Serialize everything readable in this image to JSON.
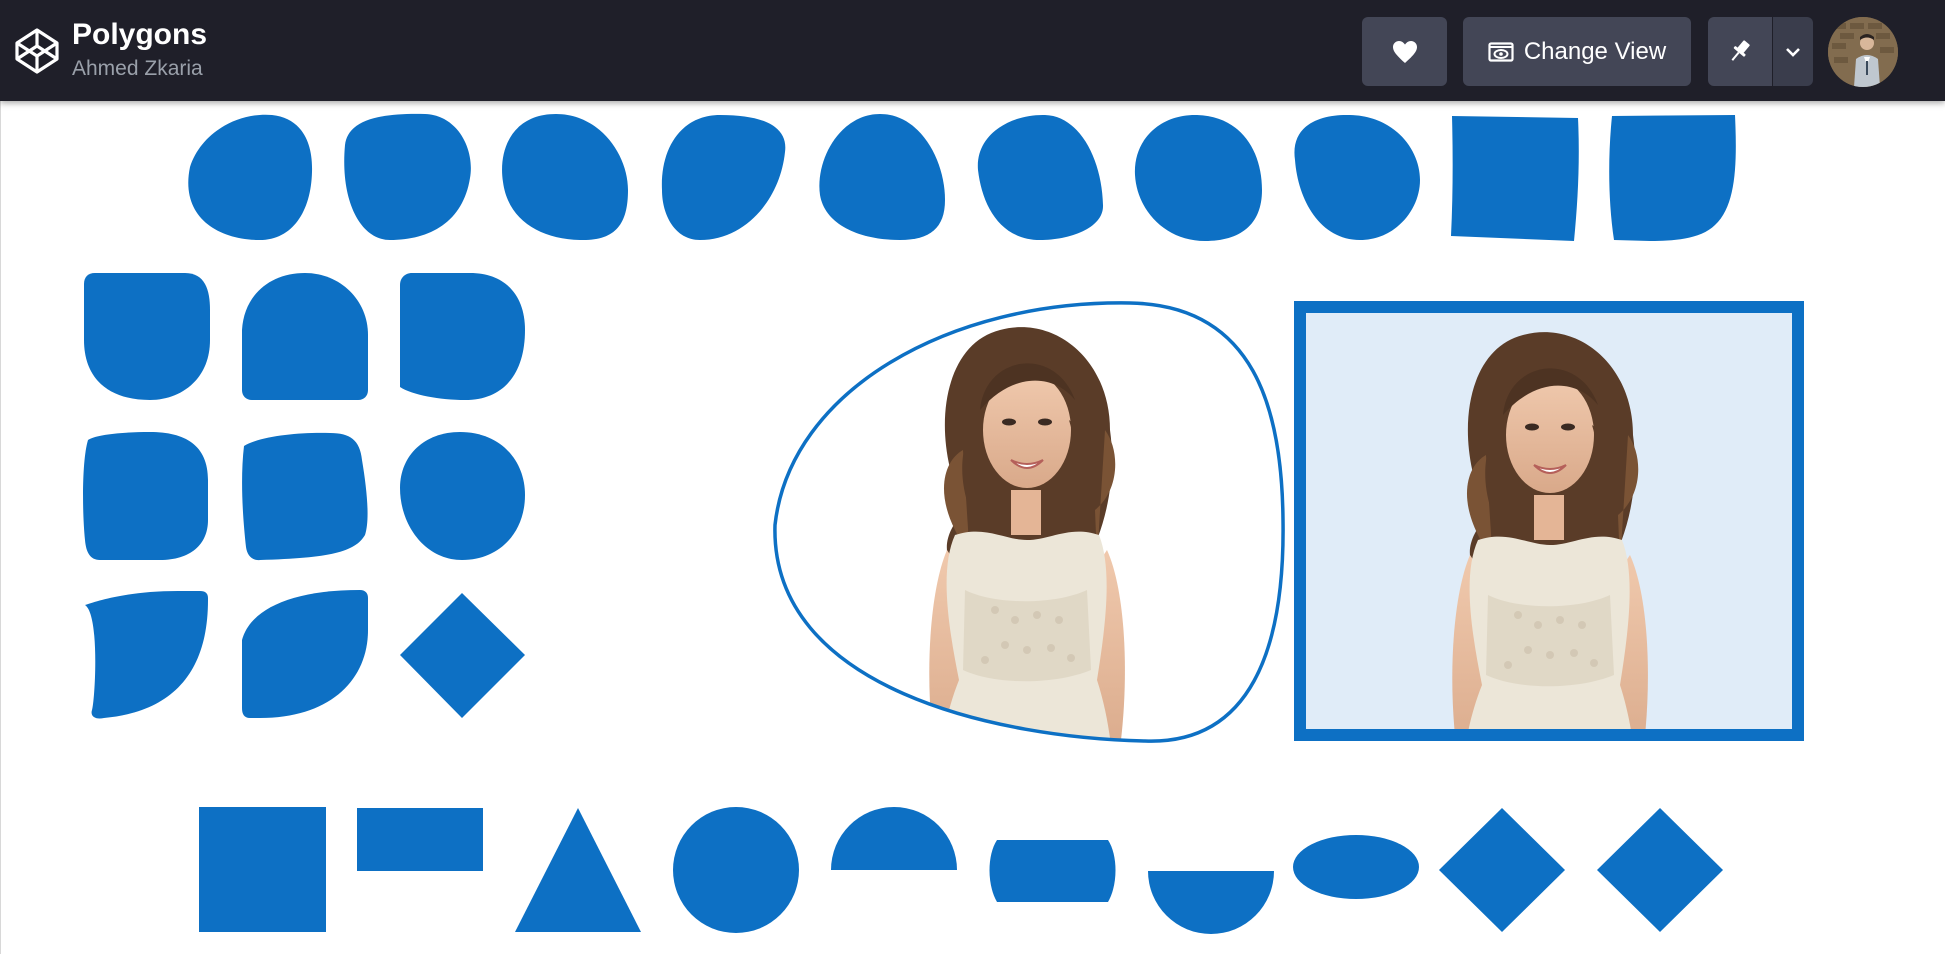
{
  "app": {
    "title": "Polygons",
    "author": "Ahmed Zkaria"
  },
  "toolbar": {
    "like_icon": "heart-icon",
    "change_view_icon": "eye-icon",
    "change_view_label": "Change View",
    "pin_icon": "pin-icon",
    "more_icon": "chevron-down-icon",
    "avatar_icon": "user-avatar"
  },
  "colors": {
    "topbar": "#1f1f29",
    "button": "#434656",
    "shape_blue": "#0d70c4",
    "frame_background": "#e0ecf8"
  },
  "demos": {
    "clip_outline": "blob-outline",
    "rect_frame": "bordered-rectangle",
    "portrait": "smiling-woman-portrait"
  }
}
